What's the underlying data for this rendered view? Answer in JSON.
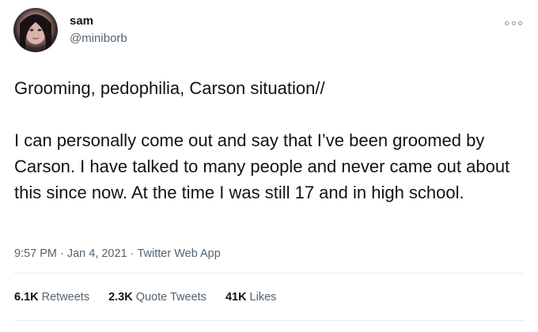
{
  "user": {
    "display_name": "sam",
    "handle": "@miniborb"
  },
  "tweet": {
    "text": "Grooming, pedophilia, Carson situation//\n\nI can personally come out and say that I’ve been groomed by Carson. I have talked to many people and never came out about this since now. At the time I was still 17 and in high school."
  },
  "meta": {
    "time": "9:57 PM",
    "separator_1": "·",
    "date": "Jan 4, 2021",
    "separator_2": "·",
    "source": "Twitter Web App"
  },
  "stats": [
    {
      "count": "6.1K",
      "label": "Retweets"
    },
    {
      "count": "2.3K",
      "label": "Quote Tweets"
    },
    {
      "count": "41K",
      "label": "Likes"
    }
  ],
  "icons": {
    "more": "more-horizontal-icon"
  }
}
